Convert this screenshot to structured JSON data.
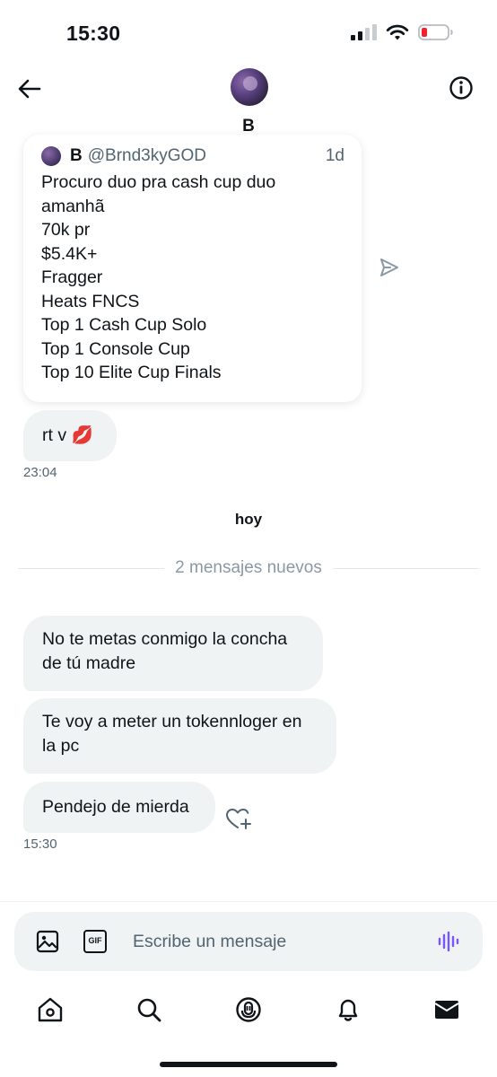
{
  "status_bar": {
    "time": "15:30"
  },
  "header": {
    "name": "B"
  },
  "quoted_tweet": {
    "name": "B",
    "handle": "@Brnd3kyGOD",
    "time": "1d",
    "lines": [
      "Procuro duo pra cash cup duo",
      "amanhã",
      "70k pr",
      "$5.4K+",
      "Fragger",
      "Heats FNCS",
      "Top 1 Cash Cup Solo",
      "Top 1 Console Cup",
      "Top 10 Elite Cup Finals"
    ]
  },
  "messages_before": [
    {
      "text": "rt v 💋"
    }
  ],
  "time_before": "23:04",
  "day_label": "hoy",
  "new_messages_label": "2 mensajes nuevos",
  "messages_today": [
    {
      "line1": "No te metas conmigo la concha",
      "line2": "de tú madre"
    },
    {
      "line1": "Te voy a meter un tokennloger en",
      "line2": "la pc"
    },
    {
      "line1": "Pendejo de mierda"
    }
  ],
  "time_today": "15:30",
  "composer": {
    "placeholder": "Escribe un mensaje",
    "gif_label": "GIF"
  },
  "colors": {
    "bubble_bg": "#eff3f4",
    "text": "#0f1419",
    "muted": "#536471",
    "accent_voice": "#7856ff",
    "battery_low": "#f4212e"
  },
  "icons": {
    "back": "arrow-left-icon",
    "info": "info-circle-icon",
    "share": "send-icon",
    "like": "heart-plus-icon",
    "media": "image-icon",
    "gif": "gif-icon",
    "voice": "waveform-icon",
    "home": "home-icon",
    "search": "search-icon",
    "spaces": "microphone-icon",
    "notifications": "bell-icon",
    "messages": "envelope-icon"
  }
}
